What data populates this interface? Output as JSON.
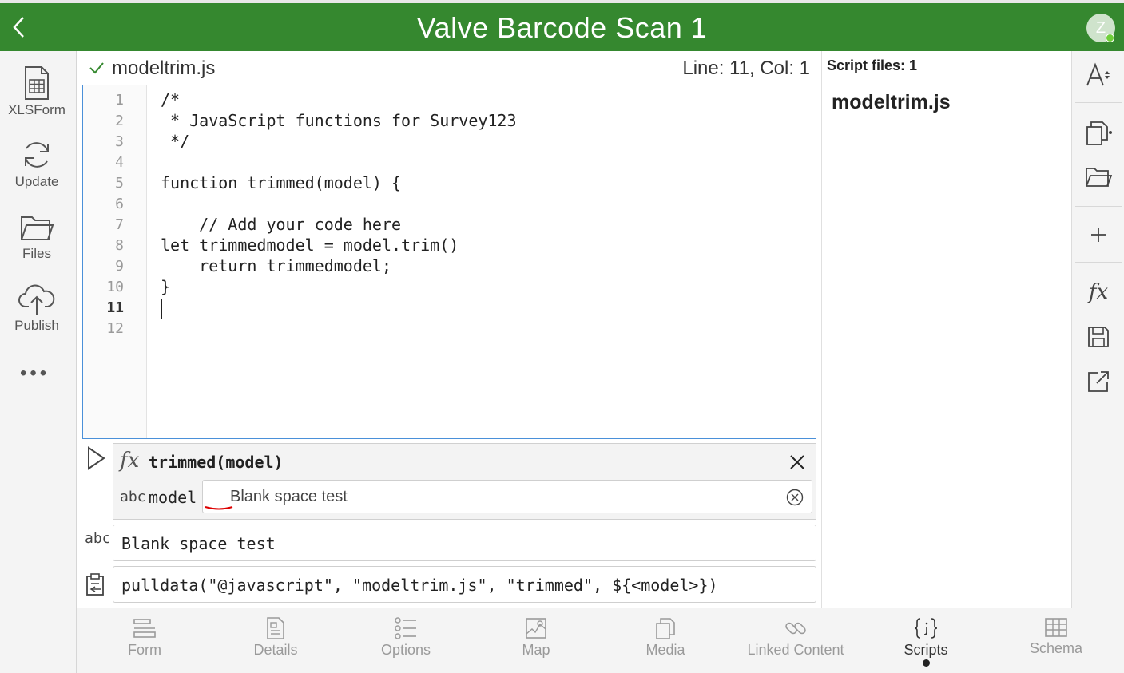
{
  "header": {
    "title": "Valve Barcode Scan 1",
    "avatar_initial": "Z",
    "bg_color": "#35882f"
  },
  "left_nav": {
    "items": [
      {
        "label": "XLSForm",
        "icon": "spreadsheet-icon"
      },
      {
        "label": "Update",
        "icon": "refresh-icon"
      },
      {
        "label": "Files",
        "icon": "folder-icon"
      },
      {
        "label": "Publish",
        "icon": "cloud-upload-icon"
      }
    ],
    "more": "•••"
  },
  "editor": {
    "file_name": "modeltrim.js",
    "cursor_position": "Line: 11, Col: 1",
    "active_line": 11,
    "lines": [
      "/*",
      " * JavaScript functions for Survey123",
      " */",
      "",
      "function trimmed(model) {",
      "",
      "    // Add your code here",
      "let trimmedmodel = model.trim()",
      "    return trimmedmodel;",
      "}",
      "",
      ""
    ],
    "line_numbers": [
      "1",
      "2",
      "3",
      "4",
      "5",
      "6",
      "7",
      "8",
      "9",
      "10",
      "11",
      "12"
    ]
  },
  "tester": {
    "fx": "fx",
    "signature": "trimmed(model)",
    "param_type": "abc",
    "param_name": "model",
    "param_value": "   Blank space test",
    "result_type": "abc",
    "result_value": "Blank space test",
    "expression": "pulldata(\"@javascript\", \"modeltrim.js\", \"trimmed\", ${<model>})"
  },
  "files_panel": {
    "count_label": "Script files: 1",
    "files": [
      "modeltrim.js"
    ]
  },
  "bottom_tabs": [
    {
      "label": "Form",
      "icon": "form-icon"
    },
    {
      "label": "Details",
      "icon": "details-icon"
    },
    {
      "label": "Options",
      "icon": "options-list-icon"
    },
    {
      "label": "Map",
      "icon": "map-icon"
    },
    {
      "label": "Media",
      "icon": "media-icon"
    },
    {
      "label": "Linked Content",
      "icon": "link-icon"
    },
    {
      "label": "Scripts",
      "icon": "braces-icon",
      "active": true
    },
    {
      "label": "Schema",
      "icon": "table-icon"
    }
  ]
}
